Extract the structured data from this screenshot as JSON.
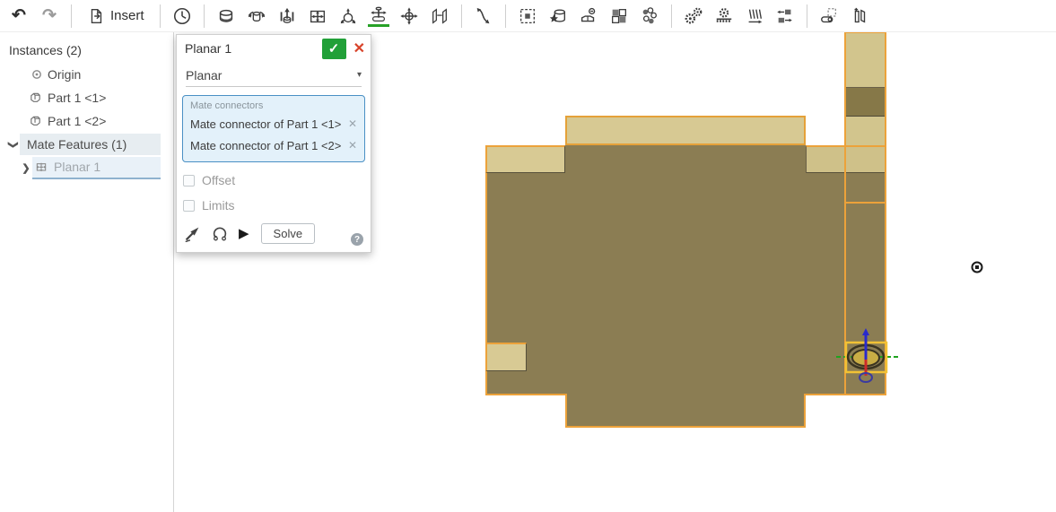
{
  "app": {
    "name": "Onshape assembly workspace"
  },
  "toolbar": {
    "undo_glyph": "↶",
    "redo_glyph": "↷",
    "insert_label": "Insert",
    "icons": [
      "undo-icon",
      "redo-icon",
      "insert-icon",
      "history-icon",
      "fastened-mate-icon",
      "revolute-mate-icon",
      "slider-mate-icon",
      "planar-mate-icon",
      "ball-mate-icon",
      "pin-slot-mate-icon",
      "cylindrical-mate-icon",
      "parallel-mate-icon",
      "tangent-mate-icon",
      "group-icon",
      "mate-connector-icon",
      "replicate-icon",
      "pattern-icon",
      "interference-icon",
      "gear-relation-icon",
      "rack-pinion-relation-icon",
      "screw-relation-icon",
      "belt-relation-icon",
      "display-states-icon",
      "exploded-view-icon"
    ],
    "active_tool_underline_color": "#27a127"
  },
  "sidebar": {
    "instances_header": "Instances (2)",
    "items": [
      {
        "label": "Origin",
        "icon": "origin-icon"
      },
      {
        "label": "Part 1 <1>",
        "icon": "part-icon"
      },
      {
        "label": "Part 1 <2>",
        "icon": "part-icon"
      }
    ],
    "mate_features_header": "Mate Features (1)",
    "mate_items": [
      {
        "label": "Planar 1",
        "icon": "planar-mate-icon"
      }
    ]
  },
  "dialog": {
    "title": "Planar 1",
    "accept_glyph": "✓",
    "close_glyph": "✕",
    "type_value": "Planar",
    "caret_glyph": "▾",
    "connectors_label": "Mate connectors",
    "connectors": [
      "Mate connector of Part 1 <1>",
      "Mate connector of Part 1 <2>"
    ],
    "remove_glyph": "✕",
    "offset_label": "Offset",
    "offset_checked": false,
    "limits_label": "Limits",
    "limits_checked": false,
    "play_glyph": "▶",
    "solve_label": "Solve",
    "help_glyph": "?"
  },
  "tree_glyphs": {
    "chevron": "❯"
  },
  "viewport": {
    "parts": [
      "Part 1 <1>",
      "Part 1 <2>"
    ],
    "colors": {
      "part_light": "#d7c993",
      "part_light_shaded": "#cfc189",
      "part_dark": "#8b7d53",
      "part_dark_shaded": "#867848",
      "selection_outline_orange": "#eca23a",
      "mate_highlight_yellow": "#f2c235",
      "axis_z_blue": "#2a2acc",
      "axis_x_red": "#cc2a2a",
      "axis_y_green": "#1fa31f"
    }
  }
}
